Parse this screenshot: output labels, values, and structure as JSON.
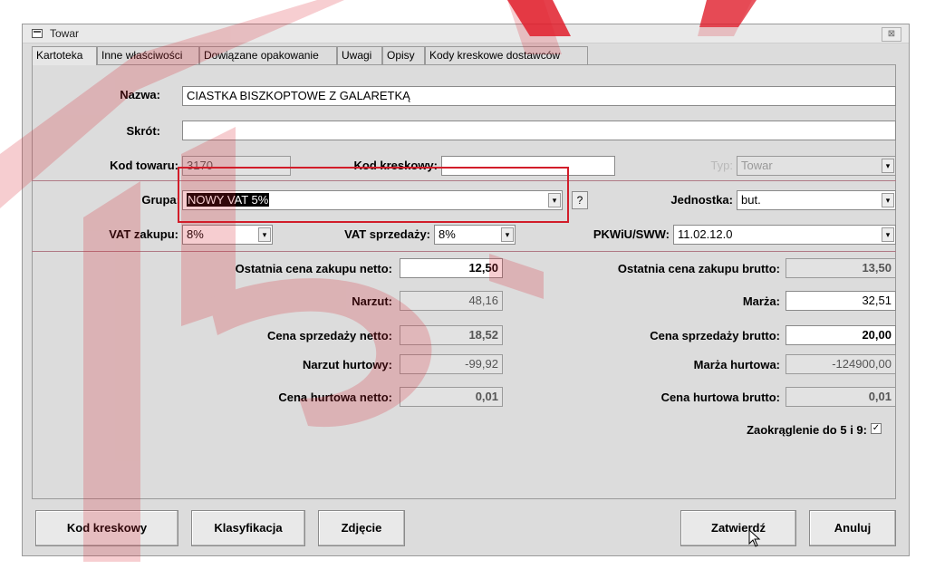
{
  "window": {
    "title": "Towar",
    "close_glyph": "⊠"
  },
  "tabs": [
    {
      "label": "Kartoteka",
      "active": true
    },
    {
      "label": "Inne właściwości",
      "active": false
    },
    {
      "label": "Dowiązane opakowanie",
      "active": false
    },
    {
      "label": "Uwagi",
      "active": false
    },
    {
      "label": "Opisy",
      "active": false
    },
    {
      "label": "Kody kreskowe dostawców",
      "active": false
    }
  ],
  "fields": {
    "nazwa": {
      "label": "Nazwa:",
      "value": "CIASTKA BISZKOPTOWE Z GALARETKĄ"
    },
    "skrot": {
      "label": "Skrót:",
      "value": ""
    },
    "kod_towaru": {
      "label": "Kod towaru:",
      "value": "3170"
    },
    "kod_kreskowy": {
      "label": "Kod kreskowy:",
      "value": ""
    },
    "typ": {
      "label": "Typ:",
      "value": "Towar"
    },
    "grupa": {
      "label": "Grupa:",
      "value": "NOWY VAT 5%"
    },
    "grupa_help": "?",
    "jednostka": {
      "label": "Jednostka:",
      "value": "but."
    },
    "vat_zakupu": {
      "label": "VAT zakupu:",
      "value": "8%"
    },
    "vat_sprzedazy": {
      "label": "VAT sprzedaży:",
      "value": "8%"
    },
    "pkwiu": {
      "label": "PKWiU/SWW:",
      "value": "11.02.12.0"
    }
  },
  "prices": {
    "ostatnia_netto": {
      "label": "Ostatnia cena zakupu netto:",
      "value": "12,50"
    },
    "ostatnia_brutto": {
      "label": "Ostatnia cena zakupu brutto:",
      "value": "13,50"
    },
    "narzut": {
      "label": "Narzut:",
      "value": "48,16"
    },
    "marza": {
      "label": "Marża:",
      "value": "32,51"
    },
    "sprzedazy_netto": {
      "label": "Cena sprzedaży netto:",
      "value": "18,52"
    },
    "sprzedazy_brutto": {
      "label": "Cena sprzedaży brutto:",
      "value": "20,00"
    },
    "narzut_hurtowy": {
      "label": "Narzut hurtowy:",
      "value": "-99,92"
    },
    "marza_hurtowa": {
      "label": "Marża hurtowa:",
      "value": "-124900,00"
    },
    "hurtowa_netto": {
      "label": "Cena hurtowa netto:",
      "value": "0,01"
    },
    "hurtowa_brutto": {
      "label": "Cena hurtowa brutto:",
      "value": "0,01"
    },
    "zaokraglenie": {
      "label": "Zaokrąglenie do 5 i 9:",
      "checked": true
    }
  },
  "buttons": {
    "kod_kreskowy": "Kod kreskowy",
    "klasyfikacja": "Klasyfikacja",
    "zdjecie": "Zdjęcie",
    "zatwierdz": "Zatwierdź",
    "anuluj": "Anuluj"
  },
  "glyphs": {
    "dropdown": "▾",
    "check": "✓"
  },
  "colors": {
    "highlight_box": "#d21d2a",
    "watermark": "#d9202c",
    "separator": "#b07a85"
  }
}
